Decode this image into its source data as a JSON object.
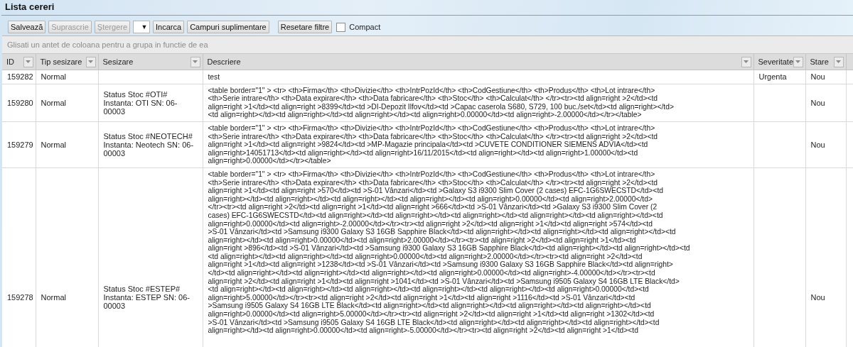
{
  "title": "Lista cereri",
  "toolbar": [
    {
      "kind": "button",
      "label": "Salvează",
      "disabled": false
    },
    {
      "kind": "button",
      "label": "Suprascrie",
      "disabled": true
    },
    {
      "kind": "button",
      "label": "Ștergere",
      "disabled": true
    },
    {
      "kind": "dropdown",
      "label": "▼"
    },
    {
      "kind": "button",
      "label": "Incarca",
      "disabled": false
    },
    {
      "kind": "button",
      "label": "Campuri suplimentare",
      "disabled": false
    },
    {
      "kind": "gap"
    },
    {
      "kind": "button",
      "label": "Resetare filtre",
      "disabled": false
    },
    {
      "kind": "checkbox",
      "label": "Compact",
      "checked": false
    }
  ],
  "group_hint": "Glisati un antet de coloana pentru a grupa in functie de ea",
  "columns": [
    {
      "label": "ID"
    },
    {
      "label": "Tip sesizare"
    },
    {
      "label": "Sesizare"
    },
    {
      "label": "Descriere"
    },
    {
      "label": "Severitate"
    },
    {
      "label": "Stare"
    }
  ],
  "rows": [
    {
      "id": "159282",
      "type": "Normal",
      "subject_lines": [],
      "description_lines": [
        "test"
      ],
      "severity": "Urgenta",
      "status": "Nou"
    },
    {
      "id": "159280",
      "type": "Normal",
      "subject_lines": [
        "Status Stoc #OTI#",
        "Instanta: OTI SN: 06-",
        "00003"
      ],
      "description_lines": [
        "<table border=\"1\" > <tr> <th>Firma</th> <th>Divizie</th> <th>IntrPozId</th> <th>CodGestiune</th> <th>Produs</th> <th>Lot intrare</th>",
        "<th>Serie intrare</th> <th>Data expirare</th> <th>Data fabricare</th> <th>Stoc</th> <th>Calculat</th> </tr><tr><td align=right >2</td><td",
        "align=right >1</td><td align=right >8399</td><td >DI-Depozit Ilfov</td><td >Capac caserola S680, S729, 100 buc./set</td><td align=right></td>",
        "<td align=right></td><td align=right></td><td align=right></td><td align=right>0.00000</td><td align=right>-2.00000</td></tr></table>"
      ],
      "status": "Nou"
    },
    {
      "id": "159279",
      "type": "Normal",
      "subject_lines": [
        "Status Stoc #NEOTECH#",
        "Instanta: Neotech SN: 06-",
        "00003"
      ],
      "description_lines": [
        "<table border=\"1\" > <tr> <th>Firma</th> <th>Divizie</th> <th>IntrPozId</th> <th>CodGestiune</th> <th>Produs</th> <th>Lot intrare</th>",
        "<th>Serie intrare</th> <th>Data expirare</th> <th>Data fabricare</th> <th>Stoc</th> <th>Calculat</th> </tr><tr><td align=right >2</td><td",
        "align=right >1</td><td align=right >9824</td><td >MP-Magazie principala</td><td >CUVETE CONDITIONER SIEMENS ADVIA</td><td",
        "align=right>14051713</td><td align=right></td><td align=right>16/11/2015</td><td align=right></td><td align=right>1.00000</td><td",
        "align=right>0.00000</td></tr></table>"
      ],
      "status": "Nou"
    },
    {
      "id": "159278",
      "type": "Normal",
      "subject_lines": [
        "Status Stoc #ESTEP#",
        "Instanta: ESTEP SN: 06-",
        "00003"
      ],
      "description_lines": [
        "<table border=\"1\" > <tr> <th>Firma</th> <th>Divizie</th> <th>IntrPozId</th> <th>CodGestiune</th> <th>Produs</th> <th>Lot intrare</th>",
        "<th>Serie intrare</th> <th>Data expirare</th> <th>Data fabricare</th> <th>Stoc</th> <th>Calculat</th> </tr><tr><td align=right >2</td><td",
        "align=right >1</td><td align=right >570</td><td >S-01 Vânzari</td><td >Galaxy S3 i9300 Slim Cover (2 cases) EFC-1G6SWECSTD</td><td",
        "align=right></td><td align=right></td><td align=right></td><td align=right></td><td align=right>0.00000</td><td align=right>2.00000</td>",
        "</tr><tr><td align=right >2</td><td align=right >1</td><td align=right >666</td><td >S-01 Vânzari</td><td >Galaxy S3 i9300 Slim Cover (2",
        "cases) EFC-1G6SWECSTD</td><td align=right></td><td align=right></td><td align=right></td><td align=right></td><td align=right></td><td",
        "align=right>0.00000</td><td align=right>-2.00000</td></tr><tr><td align=right >2</td><td align=right >1</td><td align=right >574</td><td",
        ">S-01 Vânzari</td><td >Samsung i9300 Galaxy S3 16GB Sapphire Black</td><td align=right></td><td align=right></td><td align=right></td><td",
        "align=right></td><td align=right>0.00000</td><td align=right>2.00000</td></tr><tr><td align=right >2</td><td align=right >1</td><td",
        "align=right >896</td><td >S-01 Vânzari</td><td >Samsung i9300 Galaxy S3 16GB Sapphire Black</td><td align=right></td><td align=right></td><td",
        "<td align=right></td><td align=right></td><td align=right>0.00000</td><td align=right>2.00000</td></tr><tr><td align=right >2</td><td",
        "align=right >1</td><td align=right >1238</td><td >S-01 Vânzari</td><td >Samsung i9300 Galaxy S3 16GB Sapphire Black</td><td align=right>",
        "</td><td align=right></td><td align=right></td><td align=right></td><td align=right>0.00000</td><td align=right>-4.00000</td></tr><tr><td",
        "align=right >2</td><td align=right >1</td><td align=right >1041</td><td >S-01 Vânzari</td><td >Samsung i9505 Galaxy S4 16GB LTE Black</td>",
        "<td align=right></td><td align=right></td><td align=right></td><td align=right></td><td align=right></td><td align=right>0.00000</td><td",
        "align=right>5.00000</td></tr><tr><td align=right >2</td><td align=right >1</td><td align=right >1116</td><td >S-01 Vânzari</td><td",
        ">Samsung i9505 Galaxy S4 16GB LTE Black</td><td align=right></td><td align=right></td><td align=right></td><td align=right></td><td",
        "align=right>0.00000</td><td align=right>5.00000</td></tr><tr><td align=right >2</td><td align=right >1</td><td align=right >1302</td><td",
        ">S-01 Vânzari</td><td >Samsung i9505 Galaxy S4 16GB LTE Black</td><td align=right></td><td align=right></td><td align=right></td><td",
        "align=right></td><td align=right>0.00000</td><td align=right>-5.00000</td></tr><tr><td align=right >2</td><td align=right >1</td><td"
      ],
      "status": "Nou"
    }
  ]
}
